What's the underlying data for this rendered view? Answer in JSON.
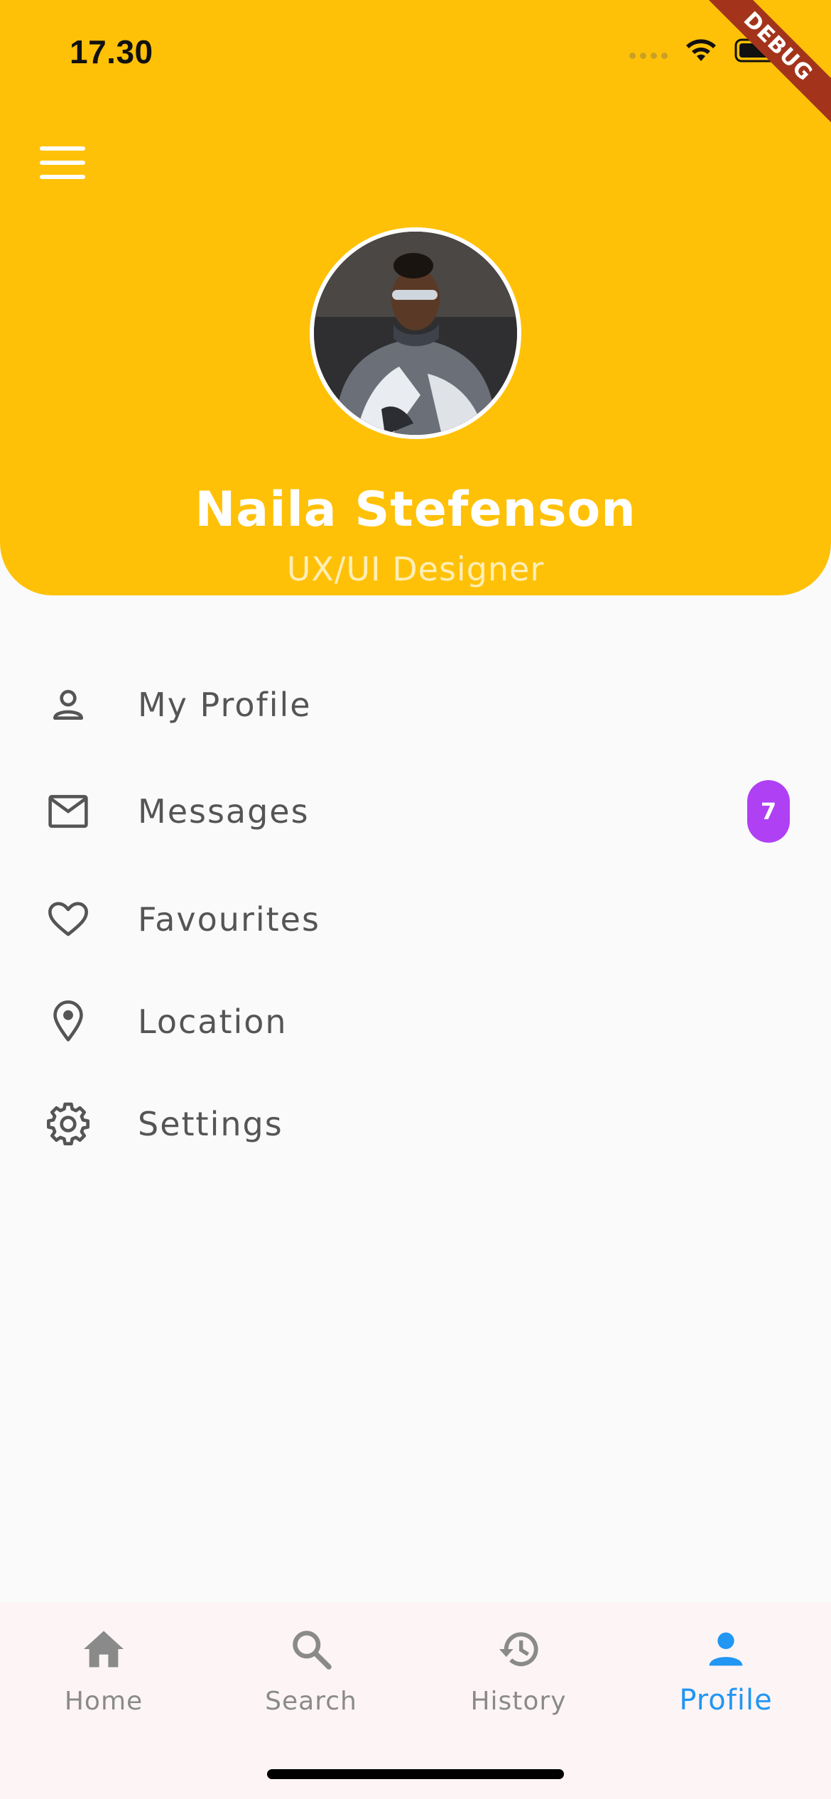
{
  "status_bar": {
    "time": "17.30"
  },
  "debug_banner": "DEBUG",
  "profile": {
    "name": "Naila Stefenson",
    "role": "UX/UI Designer"
  },
  "menu": [
    {
      "label": "My Profile",
      "icon": "person-icon"
    },
    {
      "label": "Messages",
      "icon": "mail-icon",
      "badge": "7"
    },
    {
      "label": "Favourites",
      "icon": "heart-icon"
    },
    {
      "label": "Location",
      "icon": "location-pin-icon"
    },
    {
      "label": "Settings",
      "icon": "gear-icon"
    }
  ],
  "bottom_nav": [
    {
      "label": "Home",
      "icon": "home-icon"
    },
    {
      "label": "Search",
      "icon": "search-icon"
    },
    {
      "label": "History",
      "icon": "history-icon"
    },
    {
      "label": "Profile",
      "icon": "person-icon",
      "active": true
    }
  ],
  "colors": {
    "header": "#FFC107",
    "badge": "#B040F4",
    "active_nav": "#2196F3",
    "background": "#FAFAFA"
  }
}
